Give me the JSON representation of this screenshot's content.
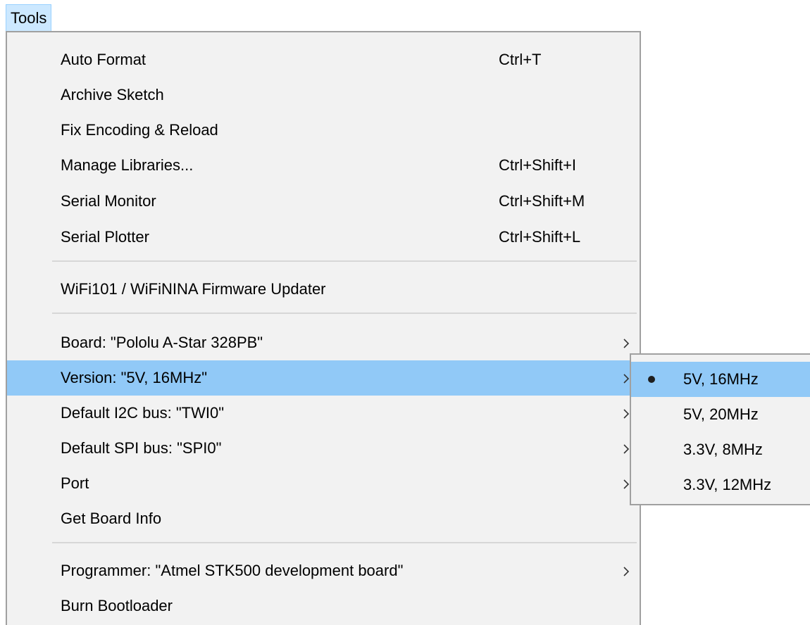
{
  "menubar": {
    "title": "Tools"
  },
  "menu": {
    "groups": [
      {
        "items": [
          {
            "label": "Auto Format",
            "shortcut": "Ctrl+T"
          },
          {
            "label": "Archive Sketch",
            "shortcut": ""
          },
          {
            "label": "Fix Encoding & Reload",
            "shortcut": ""
          },
          {
            "label": "Manage Libraries...",
            "shortcut": "Ctrl+Shift+I"
          },
          {
            "label": "Serial Monitor",
            "shortcut": "Ctrl+Shift+M"
          },
          {
            "label": "Serial Plotter",
            "shortcut": "Ctrl+Shift+L"
          }
        ]
      },
      {
        "items": [
          {
            "label": "WiFi101 / WiFiNINA Firmware Updater",
            "shortcut": ""
          }
        ]
      },
      {
        "items": [
          {
            "label": "Board: \"Pololu A-Star 328PB\"",
            "submenu": true
          },
          {
            "label": "Version: \"5V, 16MHz\"",
            "submenu": true,
            "highlighted": true
          },
          {
            "label": "Default I2C bus: \"TWI0\"",
            "submenu": true
          },
          {
            "label": "Default SPI bus: \"SPI0\"",
            "submenu": true
          },
          {
            "label": "Port",
            "submenu": true
          },
          {
            "label": "Get Board Info",
            "submenu": false
          }
        ]
      },
      {
        "items": [
          {
            "label": "Programmer: \"Atmel STK500 development board\"",
            "submenu": true
          },
          {
            "label": "Burn Bootloader",
            "submenu": false
          }
        ]
      }
    ]
  },
  "submenu": {
    "parent": "Version: \"5V, 16MHz\"",
    "options": [
      {
        "label": "5V, 16MHz",
        "selected": true,
        "highlighted": true
      },
      {
        "label": "5V, 20MHz",
        "selected": false
      },
      {
        "label": "3.3V, 8MHz",
        "selected": false
      },
      {
        "label": "3.3V, 12MHz",
        "selected": false
      }
    ]
  },
  "colors": {
    "menu_background": "#f2f2f2",
    "highlight": "#91c9f7",
    "menubar_highlight": "#cce8ff",
    "border": "#a0a0a0",
    "separator": "#d7d7d7"
  },
  "icons": {
    "submenu_arrow": "chevron-right-icon",
    "selected_marker": "bullet-icon"
  }
}
